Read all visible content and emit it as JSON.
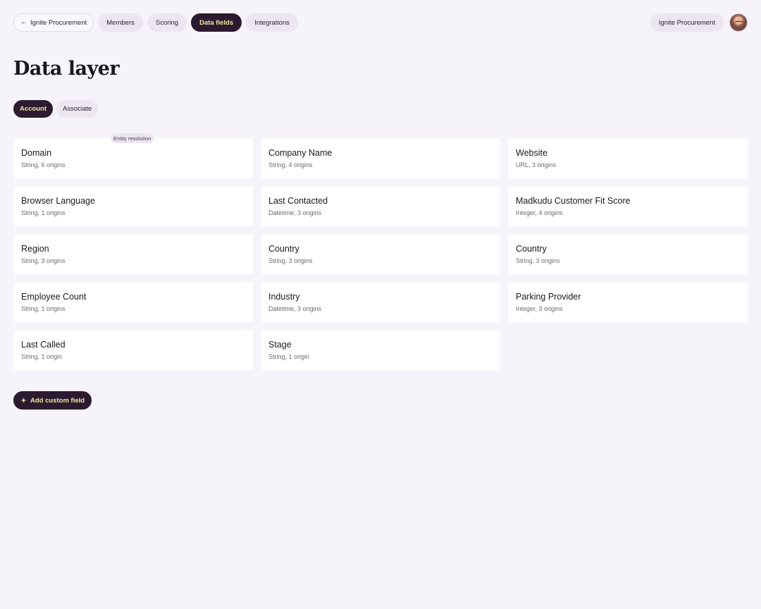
{
  "nav": {
    "back": {
      "icon": "arrow-left-icon",
      "label": "Ignite Procurement"
    },
    "items": [
      {
        "label": "Members",
        "active": false
      },
      {
        "label": "Scoring",
        "active": false
      },
      {
        "label": "Data fields",
        "active": true
      },
      {
        "label": "Integrations",
        "active": false
      }
    ]
  },
  "account": {
    "org_label": "Ignite Procurement",
    "avatar": "user-avatar"
  },
  "page": {
    "title": "Data layer"
  },
  "subtabs": [
    {
      "label": "Account",
      "active": true
    },
    {
      "label": "Associate",
      "active": false
    }
  ],
  "fields": [
    {
      "name": "Domain",
      "meta": "String, 6 origins",
      "badge": "Entity resolution"
    },
    {
      "name": "Company Name",
      "meta": "String, 4 origins"
    },
    {
      "name": "Website",
      "meta": "URL, 3 origins"
    },
    {
      "name": "Browser Language",
      "meta": "String, 1 origins"
    },
    {
      "name": "Last Contacted",
      "meta": "Datetime, 3 origins"
    },
    {
      "name": "Madkudu Customer Fit Score",
      "meta": "Integer, 4 origins"
    },
    {
      "name": "Region",
      "meta": "String, 3 origins"
    },
    {
      "name": "Country",
      "meta": "String, 3 origins"
    },
    {
      "name": "Country",
      "meta": "String, 3 origins"
    },
    {
      "name": "Employee Count",
      "meta": "String, 1 origins"
    },
    {
      "name": "Industry",
      "meta": "Datetime, 3 origins"
    },
    {
      "name": "Parking Provider",
      "meta": "Integer, 3 origins"
    },
    {
      "name": "Last Called",
      "meta": "String, 1 origin"
    },
    {
      "name": "Stage",
      "meta": "String, 1 origin"
    }
  ],
  "actions": {
    "add_custom_field": "Add custom field",
    "add_icon": "plus-icon"
  },
  "colors": {
    "accent": "#2b1a30",
    "accent_text": "#f7e7a1",
    "background": "#f6f3fa",
    "card": "#ffffff"
  }
}
